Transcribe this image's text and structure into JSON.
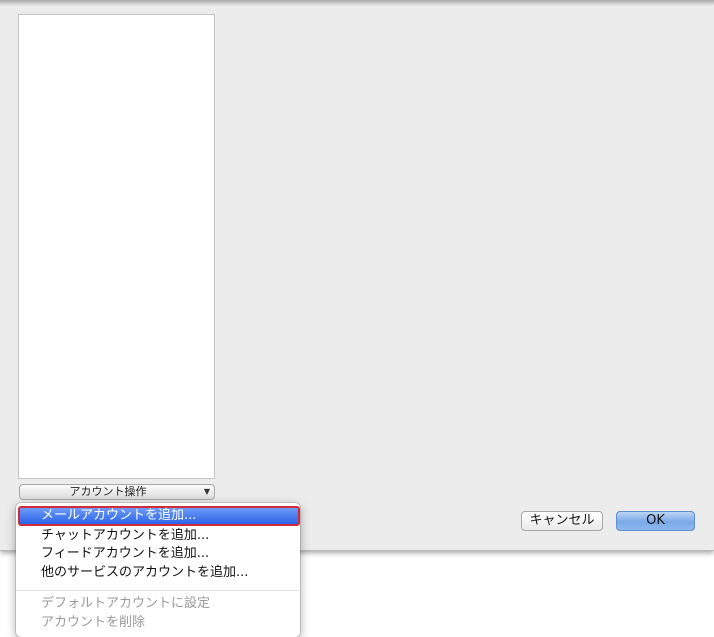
{
  "sheet": {
    "account_action_label": "アカウント操作",
    "cancel_label": "キャンセル",
    "ok_label": "OK"
  },
  "menu": {
    "items": [
      {
        "label": "メールアカウントを追加...",
        "state": "highlighted"
      },
      {
        "label": "チャットアカウントを追加...",
        "state": "enabled"
      },
      {
        "label": "フィードアカウントを追加...",
        "state": "enabled"
      },
      {
        "label": "他のサービスのアカウントを追加...",
        "state": "enabled"
      },
      {
        "label": "デフォルトアカウントに設定",
        "state": "disabled"
      },
      {
        "label": "アカウントを削除",
        "state": "disabled"
      }
    ]
  },
  "colors": {
    "highlight": "#2a63e8",
    "highlight_border": "#d42b3a",
    "sheet_background": "#ececec"
  },
  "icons": {
    "popup_arrow": "triangle-down-icon"
  }
}
